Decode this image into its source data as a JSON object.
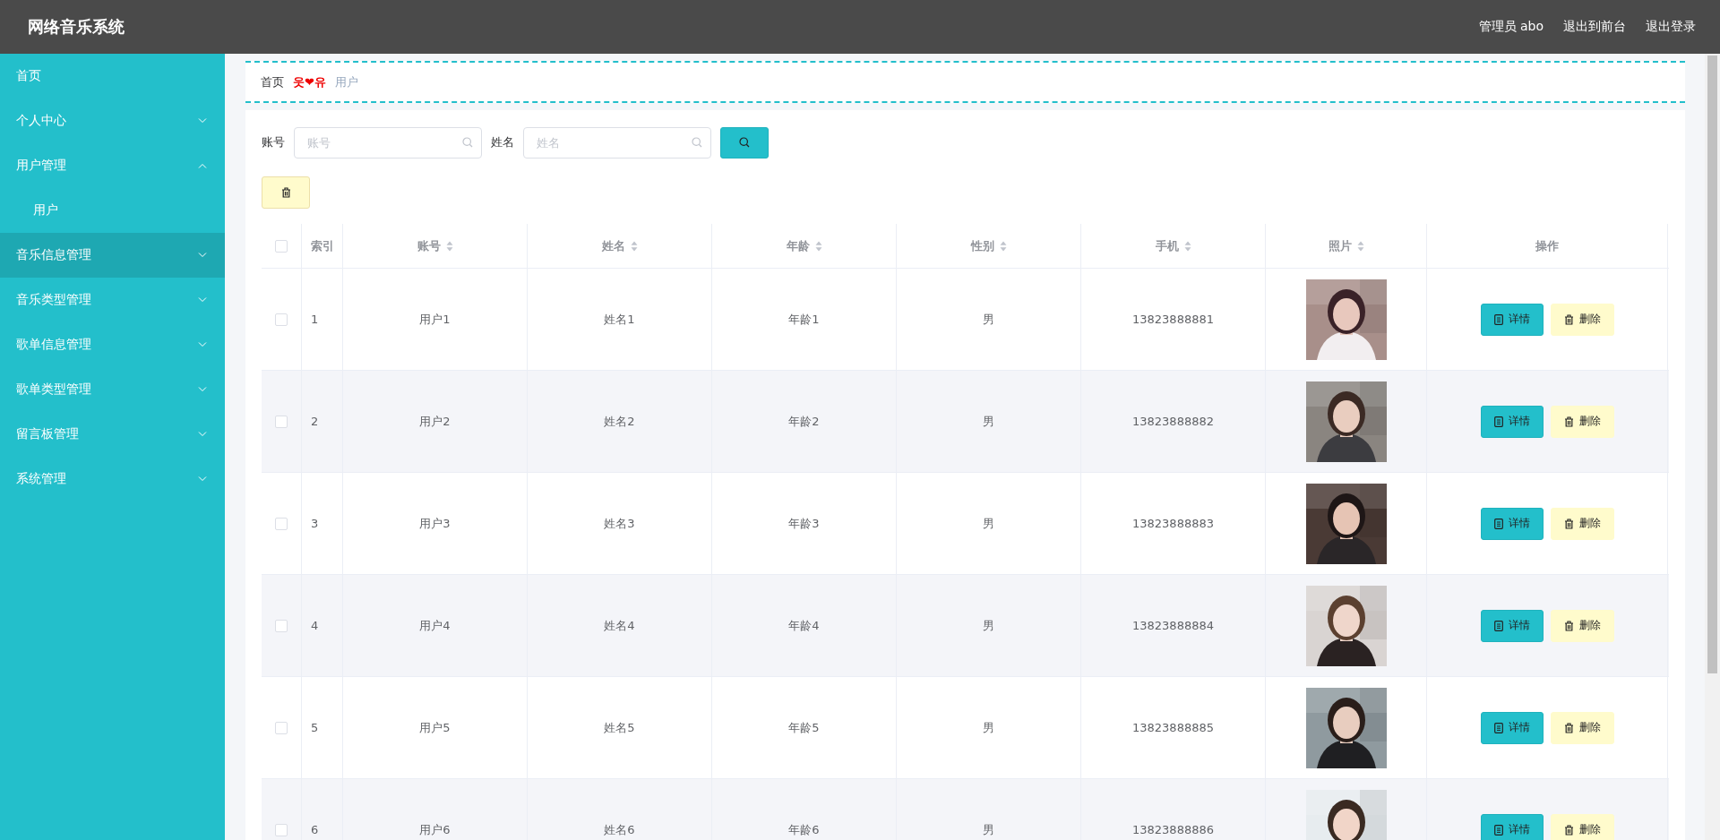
{
  "header": {
    "title": "网络音乐系统",
    "links": [
      {
        "label": "管理员 abo"
      },
      {
        "label": "退出到前台"
      },
      {
        "label": "退出登录"
      }
    ]
  },
  "sidebar": {
    "items": [
      {
        "label": "首页",
        "hovered": false
      },
      {
        "label": "个人中心",
        "hovered": false,
        "expanded": false
      },
      {
        "label": "用户管理",
        "hovered": false,
        "expanded": true,
        "children": [
          {
            "label": "用户",
            "hovered": false
          }
        ]
      },
      {
        "label": "音乐信息管理",
        "hovered": true,
        "expanded": false
      },
      {
        "label": "音乐类型管理",
        "hovered": false,
        "expanded": false
      },
      {
        "label": "歌单信息管理",
        "hovered": false,
        "expanded": false
      },
      {
        "label": "歌单类型管理",
        "hovered": false,
        "expanded": false
      },
      {
        "label": "留言板管理",
        "hovered": false,
        "expanded": false
      },
      {
        "label": "系统管理",
        "hovered": false,
        "expanded": false
      }
    ]
  },
  "breadcrumb": {
    "items": [
      "首页",
      "用户"
    ],
    "separator": "웃❤유"
  },
  "search": {
    "fields": [
      {
        "label": "账号",
        "placeholder": "账号"
      },
      {
        "label": "姓名",
        "placeholder": "姓名"
      }
    ]
  },
  "table": {
    "select_all_checked": false,
    "columns": [
      {
        "label": "索引",
        "sortable": false
      },
      {
        "label": "账号",
        "sortable": true
      },
      {
        "label": "姓名",
        "sortable": true
      },
      {
        "label": "年龄",
        "sortable": true
      },
      {
        "label": "性别",
        "sortable": true
      },
      {
        "label": "手机",
        "sortable": true
      },
      {
        "label": "照片",
        "sortable": true
      },
      {
        "label": "操作",
        "sortable": false
      }
    ],
    "rows": [
      {
        "checked": false,
        "cells": [
          "1",
          "用户1",
          "姓名1",
          "年龄1",
          "男",
          "13823888881"
        ],
        "photo": {
          "kind": "picture"
        },
        "actions": [
          "详情",
          "删除"
        ]
      },
      {
        "checked": false,
        "cells": [
          "2",
          "用户2",
          "姓名2",
          "年龄2",
          "男",
          "13823888882"
        ],
        "photo": {
          "kind": "picture"
        },
        "actions": [
          "详情",
          "删除"
        ]
      },
      {
        "checked": false,
        "cells": [
          "3",
          "用户3",
          "姓名3",
          "年龄3",
          "男",
          "13823888883"
        ],
        "photo": {
          "kind": "picture"
        },
        "actions": [
          "详情",
          "删除"
        ]
      },
      {
        "checked": false,
        "cells": [
          "4",
          "用户4",
          "姓名4",
          "年龄4",
          "男",
          "13823888884"
        ],
        "photo": {
          "kind": "picture"
        },
        "actions": [
          "详情",
          "删除"
        ]
      },
      {
        "checked": false,
        "cells": [
          "5",
          "用户5",
          "姓名5",
          "年龄5",
          "男",
          "13823888885"
        ],
        "photo": {
          "kind": "picture"
        },
        "actions": [
          "详情",
          "删除"
        ]
      },
      {
        "checked": false,
        "cells": [
          "6",
          "用户6",
          "姓名6",
          "年龄6",
          "男",
          "13823888886"
        ],
        "photo": {
          "kind": "picture"
        },
        "actions": [
          "详情",
          "删除"
        ]
      }
    ]
  }
}
